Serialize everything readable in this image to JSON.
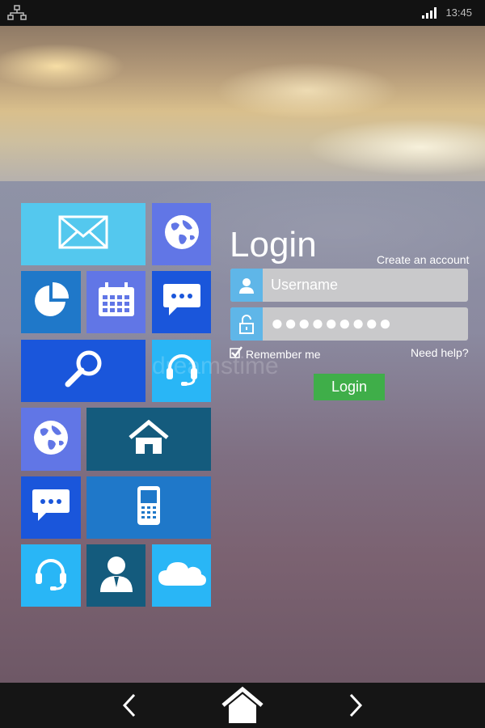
{
  "status_bar": {
    "time": "13:45",
    "network_icon": "network-icon",
    "signal_icon": "signal-icon"
  },
  "tiles": [
    {
      "icon": "mail-icon",
      "color": "#54c8ee"
    },
    {
      "icon": "globe-icon",
      "color": "#6176e6"
    },
    {
      "icon": "pie-chart-icon",
      "color": "#1f78c9"
    },
    {
      "icon": "calendar-icon",
      "color": "#6176e6"
    },
    {
      "icon": "chat-icon",
      "color": "#1a56db"
    },
    {
      "icon": "search-icon",
      "color": "#1a56db"
    },
    {
      "icon": "headset-icon",
      "color": "#29b6f6"
    },
    {
      "icon": "globe-icon",
      "color": "#6176e6"
    },
    {
      "icon": "home-icon",
      "color": "#145b7d"
    },
    {
      "icon": "chat-icon",
      "color": "#1a56db"
    },
    {
      "icon": "mobile-phone-icon",
      "color": "#1f78c9"
    },
    {
      "icon": "headset-icon",
      "color": "#29b6f6"
    },
    {
      "icon": "user-icon",
      "color": "#145b7d"
    },
    {
      "icon": "cloud-icon",
      "color": "#29b6f6"
    }
  ],
  "login": {
    "title": "Login",
    "create_account": "Create an account",
    "username_placeholder": "Username",
    "password_value": "●●●●●●●●●",
    "remember_label": "Remember me",
    "need_help": "Need help?",
    "button_label": "Login"
  },
  "watermark": "dreamstime",
  "nav": {
    "back_icon": "back-chevron-icon",
    "home_icon": "home-icon",
    "forward_icon": "forward-chevron-icon"
  }
}
